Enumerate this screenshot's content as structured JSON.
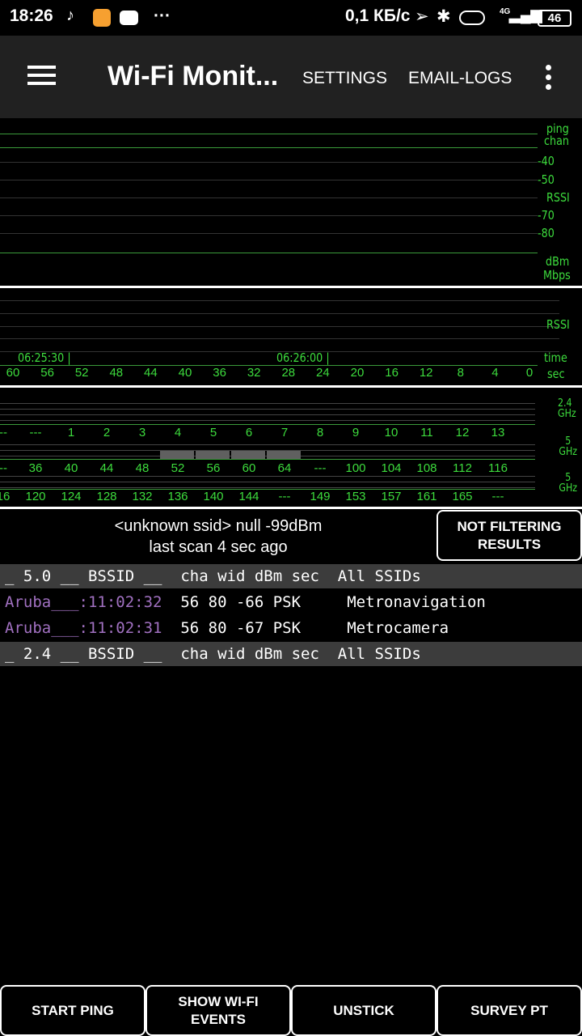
{
  "status_bar": {
    "time": "18:26",
    "speed": "0,1 КБ/с",
    "network": "4G",
    "battery": "46"
  },
  "app_bar": {
    "title": "Wi-Fi Monit...",
    "settings": "SETTINGS",
    "email_logs": "EMAIL-LOGS"
  },
  "graph1": {
    "labels": {
      "ping": "ping",
      "chan": "chan",
      "m40": "-40",
      "m50": "-50",
      "rssi": "RSSI",
      "m70": "-70",
      "m80": "-80",
      "dbm": "dBm",
      "mbps": "Mbps"
    }
  },
  "graph2": {
    "rssi": "RSSI",
    "time_label": "time",
    "sec_label": "sec",
    "time_marks": [
      "06:25:30 |",
      "06:26:00 |"
    ],
    "sec_ticks": [
      "60",
      "56",
      "52",
      "48",
      "44",
      "40",
      "36",
      "32",
      "28",
      "24",
      "20",
      "16",
      "12",
      "8",
      "4",
      "0"
    ]
  },
  "channels": {
    "band_24": "2.4 GHz",
    "band_5a": "5 GHz",
    "band_5b": "5 GHz",
    "row_24": [
      "--",
      "---",
      "1",
      "2",
      "3",
      "4",
      "5",
      "6",
      "7",
      "8",
      "9",
      "10",
      "11",
      "12",
      "13"
    ],
    "row_5a": [
      "--",
      "36",
      "40",
      "44",
      "48",
      "52",
      "56",
      "60",
      "64",
      "---",
      "100",
      "104",
      "108",
      "112",
      "116"
    ],
    "row_5b": [
      "16",
      "120",
      "124",
      "128",
      "132",
      "136",
      "140",
      "144",
      "---",
      "149",
      "153",
      "157",
      "161",
      "165",
      "---"
    ],
    "occupied_5ghz": [
      "52",
      "56",
      "60",
      "64"
    ]
  },
  "summary": {
    "line1": "<unknown ssid>  null  -99dBm",
    "line2": "last scan 4 sec ago",
    "filter_button": "NOT FILTERING RESULTS"
  },
  "table": {
    "header_5": "_ 5.0 __ BSSID __  cha wid dBm sec  All SSIDs",
    "rows": [
      {
        "bssid": "Aruba___:11:02:32",
        "info": "  56 80 -66 PSK     Metronavigation"
      },
      {
        "bssid": "Aruba___:11:02:31",
        "info": "  56 80 -67 PSK     Metrocamera"
      }
    ],
    "header_24": "_ 2.4 __ BSSID __  cha wid dBm sec  All SSIDs"
  },
  "bottom_buttons": [
    "START PING",
    "SHOW WI-FI EVENTS",
    "UNSTICK",
    "SURVEY PT"
  ],
  "colors": {
    "accent": "#3ddc3d",
    "bssid": "#a070c0",
    "header_bg": "#3c3c3c"
  }
}
